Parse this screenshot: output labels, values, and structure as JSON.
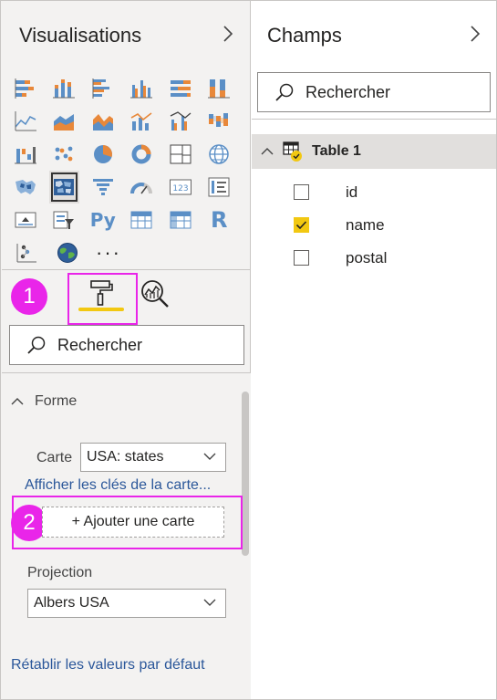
{
  "visualisations": {
    "title": "Visualisations",
    "more_label": "···",
    "py_label": "Py",
    "r_label": "R",
    "kpi_label": "123"
  },
  "format_tab": {
    "step1_badge": "1",
    "step2_badge": "2"
  },
  "left_search": {
    "placeholder": "Rechercher"
  },
  "forme": {
    "header": "Forme",
    "carte_label": "Carte",
    "carte_value": "USA: states",
    "show_keys_link": "Afficher les clés de la carte...",
    "add_map_button": "+ Ajouter une carte",
    "projection_label": "Projection",
    "projection_value": "Albers USA",
    "reset_link": "Rétablir les valeurs par défaut"
  },
  "champs": {
    "title": "Champs",
    "search_placeholder": "Rechercher",
    "table_name": "Table 1",
    "fields": [
      {
        "name": "id",
        "checked": false
      },
      {
        "name": "name",
        "checked": true
      },
      {
        "name": "postal",
        "checked": false
      }
    ]
  },
  "colors": {
    "accent_yellow": "#f2c811",
    "highlight_magenta": "#e925e9",
    "link_blue": "#2b579a",
    "chart_blue": "#5b8fc6",
    "chart_orange": "#e8883a"
  }
}
